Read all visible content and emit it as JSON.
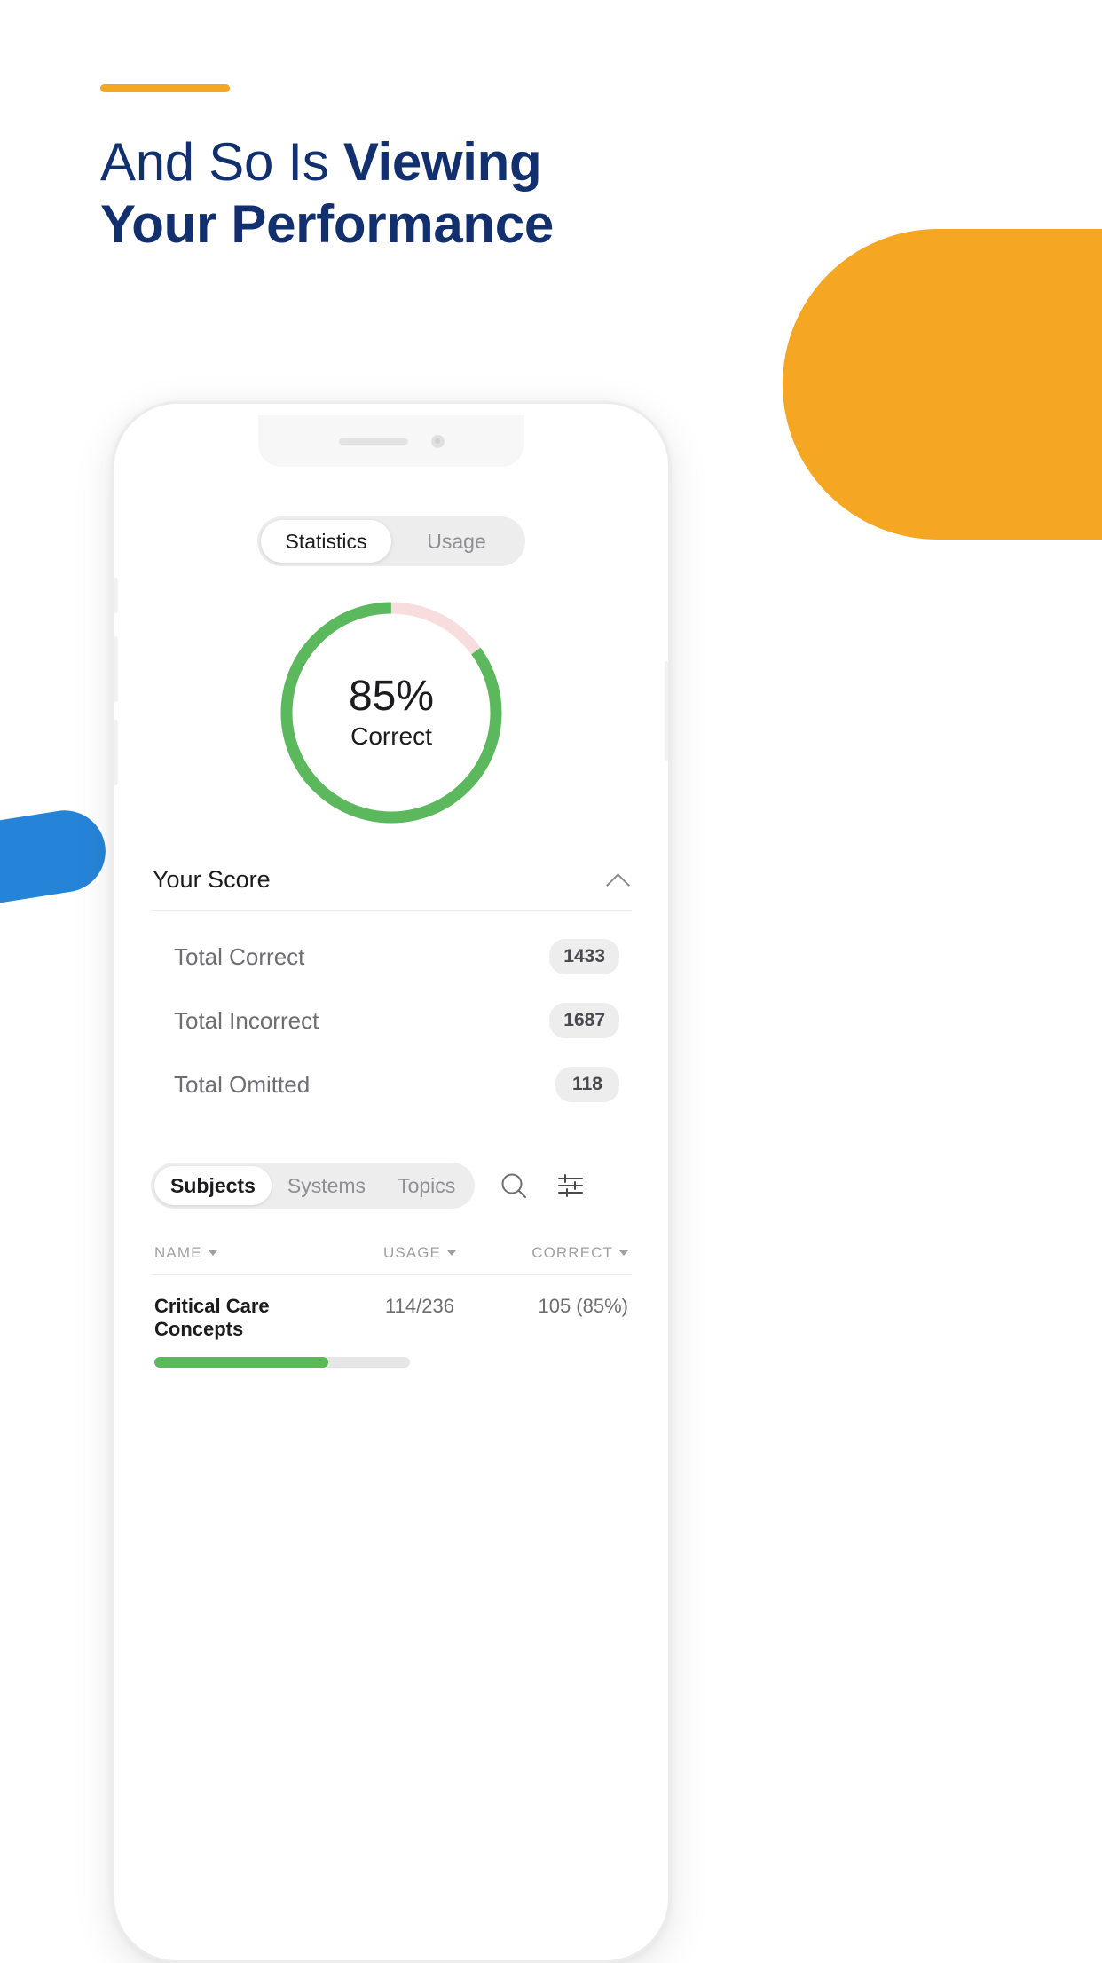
{
  "page": {
    "headline_line1_light": "And So Is ",
    "headline_line1_bold": "Viewing",
    "headline_line2_bold": "Your Performance",
    "accent_color": "#F5A623",
    "headline_color": "#12306E",
    "blue_shape_color": "#2684D8"
  },
  "app": {
    "tabs": [
      {
        "label": "Statistics",
        "active": true
      },
      {
        "label": "Usage",
        "active": false
      }
    ],
    "donut": {
      "percent_label": "85%",
      "sub_label": "Correct",
      "correct_color": "#5CB85C",
      "incorrect_color": "#F7DDDD",
      "omitted_color": "#EFEFEF"
    },
    "score_section": {
      "title": "Your Score",
      "collapse_icon": "chevron-up-icon",
      "rows": [
        {
          "label": "Total Correct",
          "value": "1433"
        },
        {
          "label": "Total Incorrect",
          "value": "1687"
        },
        {
          "label": "Total Omitted",
          "value": "118"
        }
      ]
    },
    "sub_filter": {
      "items": [
        {
          "label": "Subjects",
          "active": true
        },
        {
          "label": "Systems",
          "active": false
        },
        {
          "label": "Topics",
          "active": false
        }
      ],
      "search_icon": "search-icon",
      "filter_icon": "sliders-filter-icon"
    },
    "table": {
      "columns": [
        {
          "label": "NAME",
          "sortable": true
        },
        {
          "label": "USAGE",
          "sortable": true
        },
        {
          "label": "CORRECT",
          "sortable": true
        }
      ],
      "rows": [
        {
          "name": "Critical Care Concepts",
          "usage": "114/236",
          "correct": "105 (85%)",
          "progress_percent": 68
        }
      ]
    }
  },
  "chart_data": {
    "type": "pie",
    "title": "85% Correct",
    "categories": [
      "Correct",
      "Incorrect",
      "Omitted"
    ],
    "values": [
      85,
      11,
      4
    ],
    "colors": [
      "#5CB85C",
      "#F7DDDD",
      "#EFEFEF"
    ],
    "legend": "none",
    "center_text": "85%",
    "center_sub": "Correct"
  }
}
